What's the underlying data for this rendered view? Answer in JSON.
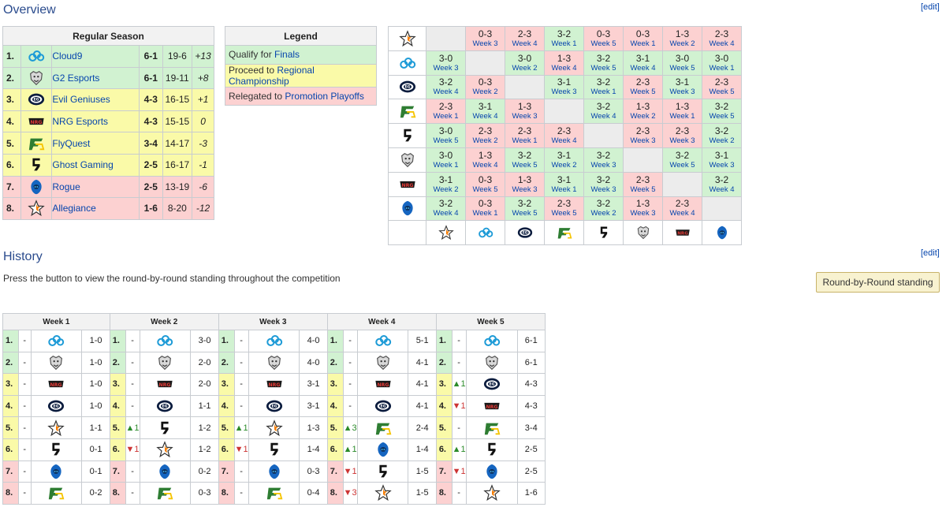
{
  "overview": {
    "title": "Overview",
    "edit": "[edit]"
  },
  "standings": {
    "header": "Regular Season",
    "rows": [
      {
        "pos": "1.",
        "team": "Cloud9",
        "icon": "cloud9-logo-icon",
        "record": "6-1",
        "games": "19-6",
        "diff": "+13",
        "zone": "g"
      },
      {
        "pos": "2.",
        "team": "G2 Esports",
        "icon": "g2-logo-icon",
        "record": "6-1",
        "games": "19-11",
        "diff": "+8",
        "zone": "g"
      },
      {
        "pos": "3.",
        "team": "Evil Geniuses",
        "icon": "eg-logo-icon",
        "record": "4-3",
        "games": "16-15",
        "diff": "+1",
        "zone": "y"
      },
      {
        "pos": "4.",
        "team": "NRG Esports",
        "icon": "nrg-logo-icon",
        "record": "4-3",
        "games": "15-15",
        "diff": "0",
        "zone": "y"
      },
      {
        "pos": "5.",
        "team": "FlyQuest",
        "icon": "flyquest-logo-icon",
        "record": "3-4",
        "games": "14-17",
        "diff": "-3",
        "zone": "y"
      },
      {
        "pos": "6.",
        "team": "Ghost Gaming",
        "icon": "ghost-logo-icon",
        "record": "2-5",
        "games": "16-17",
        "diff": "-1",
        "zone": "y"
      },
      {
        "pos": "7.",
        "team": "Rogue",
        "icon": "rogue-logo-icon",
        "record": "2-5",
        "games": "13-19",
        "diff": "-6",
        "zone": "r"
      },
      {
        "pos": "8.",
        "team": "Allegiance",
        "icon": "allegiance-logo-icon",
        "record": "1-6",
        "games": "8-20",
        "diff": "-12",
        "zone": "r"
      }
    ]
  },
  "legend": {
    "header": "Legend",
    "items": [
      {
        "prefix": "Qualify for ",
        "link": "Finals",
        "zone": "g"
      },
      {
        "prefix": "Proceed to ",
        "link": "Regional Championship",
        "zone": "y"
      },
      {
        "prefix": "Relegated to ",
        "link": "Promotion Playoffs",
        "zone": "r"
      }
    ]
  },
  "matrix": {
    "teams": [
      "allegiance",
      "cloud9",
      "eg",
      "flyquest",
      "ghost",
      "g2",
      "nrg",
      "rogue"
    ],
    "rows": [
      [
        "",
        [
          "0-3",
          "Week 3"
        ],
        [
          "2-3",
          "Week 4"
        ],
        [
          "3-2",
          "Week 1"
        ],
        [
          "0-3",
          "Week 5"
        ],
        [
          "0-3",
          "Week 1"
        ],
        [
          "1-3",
          "Week 2"
        ],
        [
          "2-3",
          "Week 4"
        ]
      ],
      [
        [
          "3-0",
          "Week 3"
        ],
        "",
        [
          "3-0",
          "Week 2"
        ],
        [
          "1-3",
          "Week 4"
        ],
        [
          "3-2",
          "Week 5"
        ],
        [
          "3-1",
          "Week 4"
        ],
        [
          "3-0",
          "Week 5"
        ],
        [
          "3-0",
          "Week 1"
        ]
      ],
      [
        [
          "3-2",
          "Week 4"
        ],
        [
          "0-3",
          "Week 2"
        ],
        "",
        [
          "3-1",
          "Week 3"
        ],
        [
          "3-2",
          "Week 1"
        ],
        [
          "2-3",
          "Week 5"
        ],
        [
          "3-1",
          "Week 3"
        ],
        [
          "2-3",
          "Week 5"
        ]
      ],
      [
        [
          "2-3",
          "Week 1"
        ],
        [
          "3-1",
          "Week 4"
        ],
        [
          "1-3",
          "Week 3"
        ],
        "",
        [
          "3-2",
          "Week 4"
        ],
        [
          "1-3",
          "Week 2"
        ],
        [
          "1-3",
          "Week 1"
        ],
        [
          "3-2",
          "Week 5"
        ]
      ],
      [
        [
          "3-0",
          "Week 5"
        ],
        [
          "2-3",
          "Week 2"
        ],
        [
          "2-3",
          "Week 1"
        ],
        [
          "2-3",
          "Week 4"
        ],
        "",
        [
          "2-3",
          "Week 3"
        ],
        [
          "2-3",
          "Week 3"
        ],
        [
          "3-2",
          "Week 2"
        ]
      ],
      [
        [
          "3-0",
          "Week 1"
        ],
        [
          "1-3",
          "Week 4"
        ],
        [
          "3-2",
          "Week 5"
        ],
        [
          "3-1",
          "Week 2"
        ],
        [
          "3-2",
          "Week 3"
        ],
        "",
        [
          "3-2",
          "Week 5"
        ],
        [
          "3-1",
          "Week 3"
        ]
      ],
      [
        [
          "3-1",
          "Week 2"
        ],
        [
          "0-3",
          "Week 5"
        ],
        [
          "1-3",
          "Week 3"
        ],
        [
          "3-1",
          "Week 1"
        ],
        [
          "3-2",
          "Week 3"
        ],
        [
          "2-3",
          "Week 5"
        ],
        "",
        [
          "3-2",
          "Week 4"
        ]
      ],
      [
        [
          "3-2",
          "Week 4"
        ],
        [
          "0-3",
          "Week 1"
        ],
        [
          "3-2",
          "Week 5"
        ],
        [
          "2-3",
          "Week 5"
        ],
        [
          "3-2",
          "Week 2"
        ],
        [
          "1-3",
          "Week 3"
        ],
        [
          "2-3",
          "Week 4"
        ],
        ""
      ]
    ]
  },
  "history": {
    "title": "History",
    "edit": "[edit]",
    "intro": "Press the button to view the round-by-round standing throughout the competition",
    "button": "Round-by-Round standing",
    "weeks": [
      {
        "label": "Week 1",
        "rows": [
          {
            "pos": "1.",
            "ch": "-",
            "team": "cloud9",
            "rec": "1-0",
            "zone": "g"
          },
          {
            "pos": "2.",
            "ch": "-",
            "team": "g2",
            "rec": "1-0",
            "zone": "g"
          },
          {
            "pos": "3.",
            "ch": "-",
            "team": "nrg",
            "rec": "1-0",
            "zone": "y"
          },
          {
            "pos": "4.",
            "ch": "-",
            "team": "eg",
            "rec": "1-0",
            "zone": "y"
          },
          {
            "pos": "5.",
            "ch": "-",
            "team": "allegiance",
            "rec": "1-1",
            "zone": "y"
          },
          {
            "pos": "6.",
            "ch": "-",
            "team": "ghost",
            "rec": "0-1",
            "zone": "y"
          },
          {
            "pos": "7.",
            "ch": "-",
            "team": "rogue",
            "rec": "0-1",
            "zone": "r"
          },
          {
            "pos": "8.",
            "ch": "-",
            "team": "flyquest",
            "rec": "0-2",
            "zone": "r"
          }
        ]
      },
      {
        "label": "Week 2",
        "rows": [
          {
            "pos": "1.",
            "ch": "-",
            "team": "cloud9",
            "rec": "3-0",
            "zone": "g"
          },
          {
            "pos": "2.",
            "ch": "-",
            "team": "g2",
            "rec": "2-0",
            "zone": "g"
          },
          {
            "pos": "3.",
            "ch": "-",
            "team": "nrg",
            "rec": "2-0",
            "zone": "y"
          },
          {
            "pos": "4.",
            "ch": "-",
            "team": "eg",
            "rec": "1-1",
            "zone": "y"
          },
          {
            "pos": "5.",
            "ch": "▲1",
            "team": "ghost",
            "rec": "1-2",
            "zone": "y"
          },
          {
            "pos": "6.",
            "ch": "▼1",
            "team": "allegiance",
            "rec": "1-2",
            "zone": "y"
          },
          {
            "pos": "7.",
            "ch": "-",
            "team": "rogue",
            "rec": "0-2",
            "zone": "r"
          },
          {
            "pos": "8.",
            "ch": "-",
            "team": "flyquest",
            "rec": "0-3",
            "zone": "r"
          }
        ]
      },
      {
        "label": "Week 3",
        "rows": [
          {
            "pos": "1.",
            "ch": "-",
            "team": "cloud9",
            "rec": "4-0",
            "zone": "g"
          },
          {
            "pos": "2.",
            "ch": "-",
            "team": "g2",
            "rec": "4-0",
            "zone": "g"
          },
          {
            "pos": "3.",
            "ch": "-",
            "team": "nrg",
            "rec": "3-1",
            "zone": "y"
          },
          {
            "pos": "4.",
            "ch": "-",
            "team": "eg",
            "rec": "3-1",
            "zone": "y"
          },
          {
            "pos": "5.",
            "ch": "▲1",
            "team": "allegiance",
            "rec": "1-3",
            "zone": "y"
          },
          {
            "pos": "6.",
            "ch": "▼1",
            "team": "ghost",
            "rec": "1-4",
            "zone": "y"
          },
          {
            "pos": "7.",
            "ch": "-",
            "team": "rogue",
            "rec": "0-3",
            "zone": "r"
          },
          {
            "pos": "8.",
            "ch": "-",
            "team": "flyquest",
            "rec": "0-4",
            "zone": "r"
          }
        ]
      },
      {
        "label": "Week 4",
        "rows": [
          {
            "pos": "1.",
            "ch": "-",
            "team": "cloud9",
            "rec": "5-1",
            "zone": "g"
          },
          {
            "pos": "2.",
            "ch": "-",
            "team": "g2",
            "rec": "4-1",
            "zone": "g"
          },
          {
            "pos": "3.",
            "ch": "-",
            "team": "nrg",
            "rec": "4-1",
            "zone": "y"
          },
          {
            "pos": "4.",
            "ch": "-",
            "team": "eg",
            "rec": "4-1",
            "zone": "y"
          },
          {
            "pos": "5.",
            "ch": "▲3",
            "team": "flyquest",
            "rec": "2-4",
            "zone": "y"
          },
          {
            "pos": "6.",
            "ch": "▲1",
            "team": "rogue",
            "rec": "1-4",
            "zone": "y"
          },
          {
            "pos": "7.",
            "ch": "▼1",
            "team": "ghost",
            "rec": "1-5",
            "zone": "r"
          },
          {
            "pos": "8.",
            "ch": "▼3",
            "team": "allegiance",
            "rec": "1-5",
            "zone": "r"
          }
        ]
      },
      {
        "label": "Week 5",
        "rows": [
          {
            "pos": "1.",
            "ch": "-",
            "team": "cloud9",
            "rec": "6-1",
            "zone": "g"
          },
          {
            "pos": "2.",
            "ch": "-",
            "team": "g2",
            "rec": "6-1",
            "zone": "g"
          },
          {
            "pos": "3.",
            "ch": "▲1",
            "team": "eg",
            "rec": "4-3",
            "zone": "y"
          },
          {
            "pos": "4.",
            "ch": "▼1",
            "team": "nrg",
            "rec": "4-3",
            "zone": "y"
          },
          {
            "pos": "5.",
            "ch": "-",
            "team": "flyquest",
            "rec": "3-4",
            "zone": "y"
          },
          {
            "pos": "6.",
            "ch": "▲1",
            "team": "ghost",
            "rec": "2-5",
            "zone": "y"
          },
          {
            "pos": "7.",
            "ch": "▼1",
            "team": "rogue",
            "rec": "2-5",
            "zone": "r"
          },
          {
            "pos": "8.",
            "ch": "-",
            "team": "allegiance",
            "rec": "1-6",
            "zone": "r"
          }
        ]
      }
    ]
  },
  "colors": {
    "qualify": "#d1f2d1",
    "proceed": "#fafaa8",
    "relegated": "#fcd1d1",
    "link": "#0645ad",
    "heading": "#2a4b8d"
  }
}
